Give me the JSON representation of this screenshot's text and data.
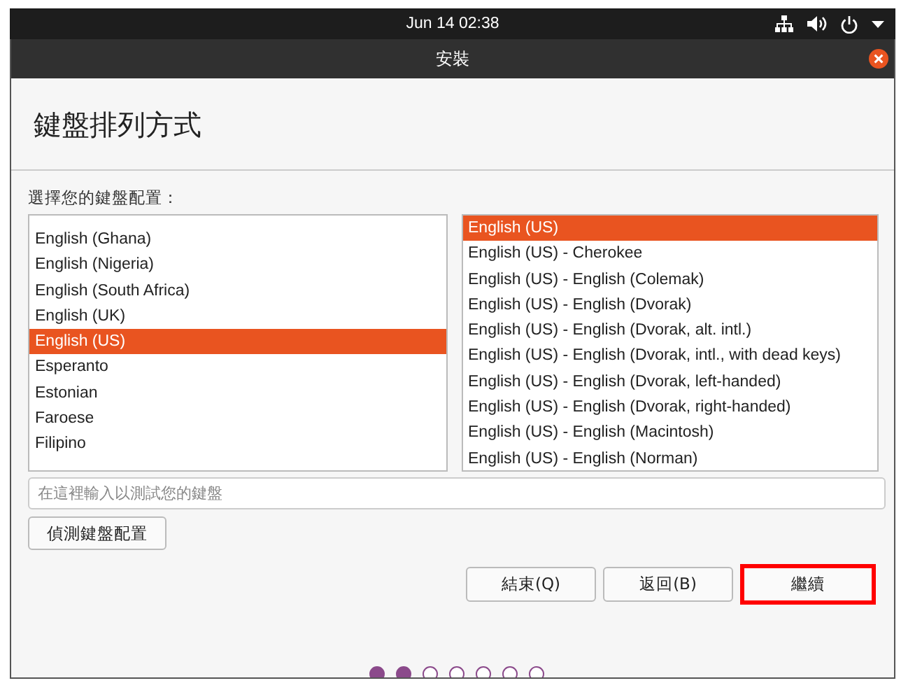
{
  "top_bar": {
    "clock": "Jun 14  02:38"
  },
  "window": {
    "title": "安裝"
  },
  "heading": "鍵盤排列方式",
  "layout_label": "選擇您的鍵盤配置：",
  "layouts": [
    {
      "label": "English (Ghana)",
      "selected": false
    },
    {
      "label": "English (Nigeria)",
      "selected": false
    },
    {
      "label": "English (South Africa)",
      "selected": false
    },
    {
      "label": "English (UK)",
      "selected": false
    },
    {
      "label": "English (US)",
      "selected": true
    },
    {
      "label": "Esperanto",
      "selected": false
    },
    {
      "label": "Estonian",
      "selected": false
    },
    {
      "label": "Faroese",
      "selected": false
    },
    {
      "label": "Filipino",
      "selected": false
    }
  ],
  "variants": [
    {
      "label": "English (US)",
      "selected": true
    },
    {
      "label": "English (US) - Cherokee",
      "selected": false
    },
    {
      "label": "English (US) - English (Colemak)",
      "selected": false
    },
    {
      "label": "English (US) - English (Dvorak)",
      "selected": false
    },
    {
      "label": "English (US) - English (Dvorak, alt. intl.)",
      "selected": false
    },
    {
      "label": "English (US) - English (Dvorak, intl., with dead keys)",
      "selected": false
    },
    {
      "label": "English (US) - English (Dvorak, left-handed)",
      "selected": false
    },
    {
      "label": "English (US) - English (Dvorak, right-handed)",
      "selected": false
    },
    {
      "label": "English (US) - English (Macintosh)",
      "selected": false
    },
    {
      "label": "English (US) - English (Norman)",
      "selected": false
    }
  ],
  "test_field": {
    "placeholder": "在這裡輸入以測試您的鍵盤"
  },
  "detect_button": "偵測鍵盤配置",
  "buttons": [
    {
      "label": "結束(Q)",
      "highlighted": false
    },
    {
      "label": "返回(B)",
      "highlighted": false
    },
    {
      "label": "繼續",
      "highlighted": true
    }
  ],
  "progress_dots": [
    {
      "done": true
    },
    {
      "done": true
    },
    {
      "done": false
    },
    {
      "done": false
    },
    {
      "done": false
    },
    {
      "done": false
    },
    {
      "done": false
    }
  ]
}
